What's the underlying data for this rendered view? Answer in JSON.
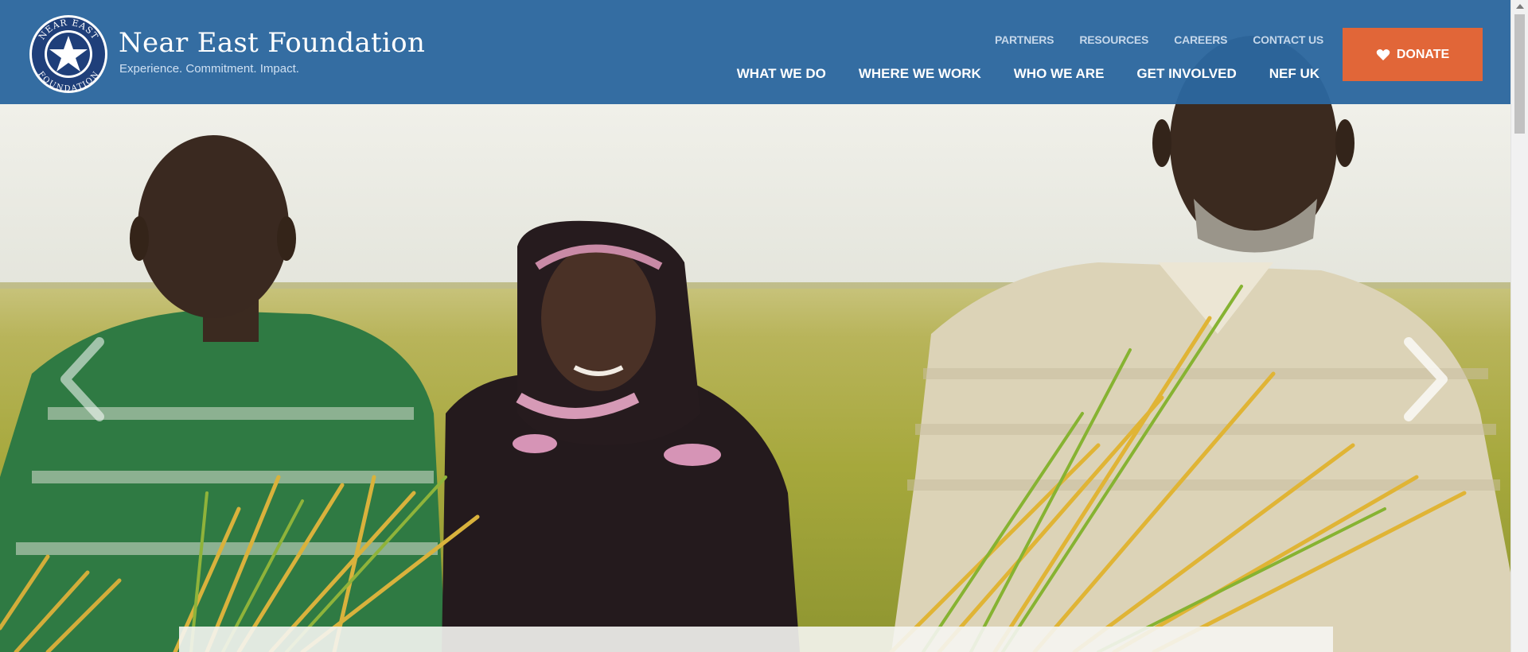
{
  "brand": {
    "name": "Near East Foundation",
    "tagline": "Experience. Commitment. Impact.",
    "seal_text_top": "NEAR EAST",
    "seal_text_bottom": "FOUNDATION"
  },
  "utility_nav": {
    "items": [
      {
        "label": "PARTNERS"
      },
      {
        "label": "RESOURCES"
      },
      {
        "label": "CAREERS"
      },
      {
        "label": "CONTACT US"
      }
    ]
  },
  "main_nav": {
    "items": [
      {
        "label": "WHAT WE DO"
      },
      {
        "label": "WHERE WE WORK"
      },
      {
        "label": "WHO WE ARE"
      },
      {
        "label": "GET INVOLVED"
      },
      {
        "label": "NEF UK"
      }
    ]
  },
  "donate": {
    "label": "DONATE",
    "icon": "heart-icon"
  },
  "hero": {
    "prev_icon": "chevron-left-icon",
    "next_icon": "chevron-right-icon"
  },
  "colors": {
    "header_bg": "#2c679e",
    "donate_bg": "#e16638",
    "nav_text": "#ffffff",
    "utility_text": "#c5d7ea"
  }
}
